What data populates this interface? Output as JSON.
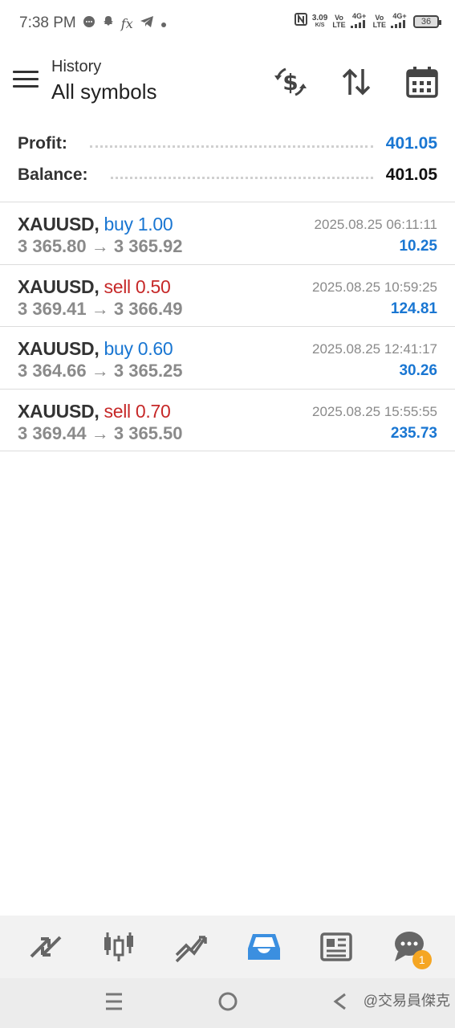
{
  "status_bar": {
    "time": "7:38 PM",
    "net_speed": "3.09",
    "net_speed_unit": "K/S",
    "sim1_top": "Vo",
    "sim1_bottom": "LTE",
    "sim1_net": "4G+",
    "sim2_top": "Vo",
    "sim2_bottom": "LTE",
    "sim2_net": "4G+",
    "battery": "36"
  },
  "header": {
    "subtitle": "History",
    "title": "All symbols"
  },
  "summary": {
    "profit_label": "Profit:",
    "profit_value": "401.05",
    "balance_label": "Balance:",
    "balance_value": "401.05"
  },
  "trades": [
    {
      "symbol": "XAUUSD,",
      "side": "buy 1.00",
      "side_type": "buy",
      "open": "3 365.80",
      "close": "3 365.92",
      "datetime": "2025.08.25 06:11:11",
      "profit": "10.25"
    },
    {
      "symbol": "XAUUSD,",
      "side": "sell 0.50",
      "side_type": "sell",
      "open": "3 369.41",
      "close": "3 366.49",
      "datetime": "2025.08.25 10:59:25",
      "profit": "124.81"
    },
    {
      "symbol": "XAUUSD,",
      "side": "buy 0.60",
      "side_type": "buy",
      "open": "3 364.66",
      "close": "3 365.25",
      "datetime": "2025.08.25 12:41:17",
      "profit": "30.26"
    },
    {
      "symbol": "XAUUSD,",
      "side": "sell 0.70",
      "side_type": "sell",
      "open": "3 369.44",
      "close": "3 365.50",
      "datetime": "2025.08.25 15:55:55",
      "profit": "235.73"
    }
  ],
  "arrow": "→",
  "tabbar": {
    "chat_badge": "1"
  },
  "watermark": "@交易員傑克",
  "colors": {
    "accent": "#1976d2",
    "buy": "#1976d2",
    "sell": "#c62828",
    "active_tab": "#3b8fe0",
    "badge": "#f5a623"
  },
  "icons": [
    "menu-icon",
    "currency-exchange-icon",
    "sort-icon",
    "calendar-icon",
    "quotes-icon",
    "chart-icon",
    "trade-icon",
    "history-icon",
    "news-icon",
    "chat-icon"
  ]
}
